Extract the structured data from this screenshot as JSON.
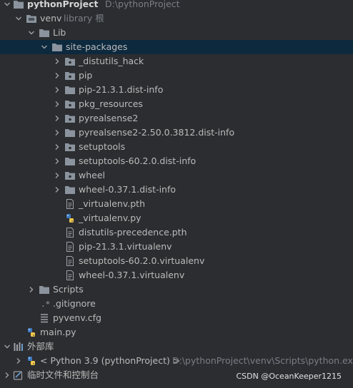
{
  "project": {
    "name": "pythonProject",
    "path": "D:\\pythonProject"
  },
  "venv": {
    "name": "venv",
    "hint": "library 根"
  },
  "lib": "Lib",
  "site_packages": "site-packages",
  "packages": [
    "_distutils_hack",
    "pip",
    "pip-21.3.1.dist-info",
    "pkg_resources",
    "pyrealsense2",
    "pyrealsense2-2.50.0.3812.dist-info",
    "setuptools",
    "setuptools-60.2.0.dist-info",
    "wheel",
    "wheel-0.37.1.dist-info"
  ],
  "files": [
    {
      "name": "_virtualenv.pth",
      "icon": "text-file-icon"
    },
    {
      "name": "_virtualenv.py",
      "icon": "python-file-icon"
    },
    {
      "name": "distutils-precedence.pth",
      "icon": "text-file-icon"
    },
    {
      "name": "pip-21.3.1.virtualenv",
      "icon": "text-file-icon"
    },
    {
      "name": "setuptools-60.2.0.virtualenv",
      "icon": "text-file-icon"
    },
    {
      "name": "wheel-0.37.1.virtualenv",
      "icon": "text-file-icon"
    }
  ],
  "scripts": "Scripts",
  "gitignore": ".gitignore",
  "pyvenv": "pyvenv.cfg",
  "main": "main.py",
  "external_libs": "外部库",
  "python_sdk": {
    "label": "< Python 3.9 (pythonProject) >",
    "path": "D:\\pythonProject\\venv\\Scripts\\python.exe"
  },
  "scratches": "临时文件和控制台",
  "watermark": "CSDN @OceanKeeper1215",
  "colors": {
    "selected": "#0d293e",
    "folder": "#8b949e",
    "python_blue": "#3e7ac1",
    "python_yellow": "#f2c94c"
  }
}
